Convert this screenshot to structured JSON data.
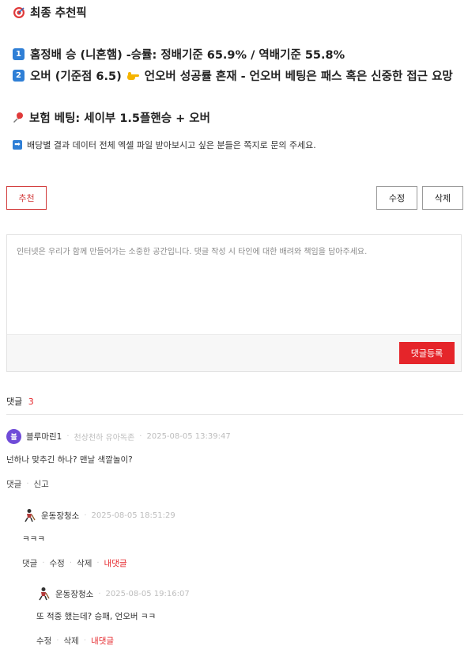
{
  "post": {
    "title": "최종 추천픽",
    "line1_num": "1",
    "line1": "홈정배 승 (니혼햄) -승률: 정배기준 65.9% / 역배기준 55.8%",
    "line2_num": "2",
    "line2_prefix": "오버 (기준점 6.5)",
    "line2_suffix": "언오버 성공률 혼재 - 언오버 베팅은 패스 혹은 신중한 접근 요망",
    "insurance": "보험 베팅: 세이부 1.5플핸승 + 오버",
    "note": "배당별 결과 데이터 전체 엑셀 파일 받아보시고 싶은 분들은 쪽지로 문의 주세요."
  },
  "actions": {
    "recommend": "추천",
    "edit": "수정",
    "delete": "삭제"
  },
  "comment_form": {
    "placeholder": "인터넷은 우리가 함께 만들어가는 소중한 공간입니다. 댓글 작성 시 타인에 대한 배려와 책임을 담아주세요.",
    "submit": "댓글등록"
  },
  "comments_header": {
    "label": "댓글",
    "count": "3"
  },
  "comments": [
    {
      "avatar_letter": "블",
      "author": "블루마린1",
      "badge": "천상천하 유아독존",
      "time": "2025-08-05 13:39:47",
      "text": "넌하나 맞추긴 하나? 맨날 색깔놀이?",
      "actions": [
        "댓글",
        "신고"
      ]
    },
    {
      "author": "운동장청소",
      "time": "2025-08-05 18:51:29",
      "text": "ㅋㅋㅋ",
      "actions": [
        "댓글",
        "수정",
        "삭제"
      ],
      "mine": "내댓글"
    },
    {
      "author": "운동장청소",
      "time": "2025-08-05 19:16:07",
      "text": "또 적중 했는데? 승패, 언오버 ㅋㅋ",
      "actions": [
        "수정",
        "삭제"
      ],
      "mine": "내댓글"
    }
  ],
  "colors": {
    "accent": "#e5252a",
    "num_badge": "#2f7fd6",
    "avatar": "#6f4bd8"
  },
  "icons": [
    "target-icon",
    "keycap-1-icon",
    "keycap-2-icon",
    "pointing-hand-icon",
    "pushpin-icon",
    "right-arrow-icon",
    "sweeper-icon"
  ]
}
